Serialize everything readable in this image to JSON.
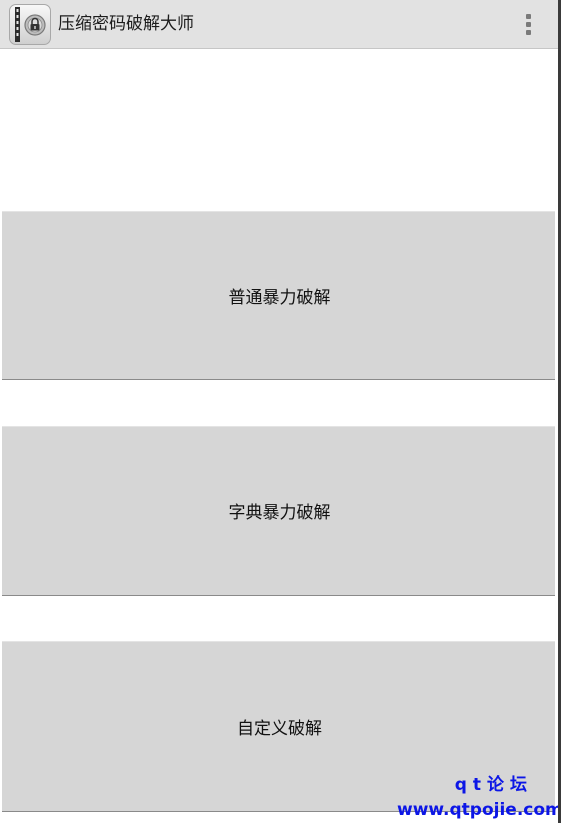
{
  "app": {
    "title": "压缩密码破解大师",
    "icon": "archive-lock-icon",
    "overflow_icon": "overflow-menu-icon"
  },
  "buttons": [
    {
      "label": "普通暴力破解"
    },
    {
      "label": "字典暴力破解"
    },
    {
      "label": "自定义破解"
    }
  ],
  "watermark": {
    "line1": "qt论坛",
    "line2": "www.qtpojie.com",
    "color": "#0c16e6"
  },
  "colors": {
    "action_bar": "#e2e2e2",
    "button": "#d6d6d6"
  }
}
